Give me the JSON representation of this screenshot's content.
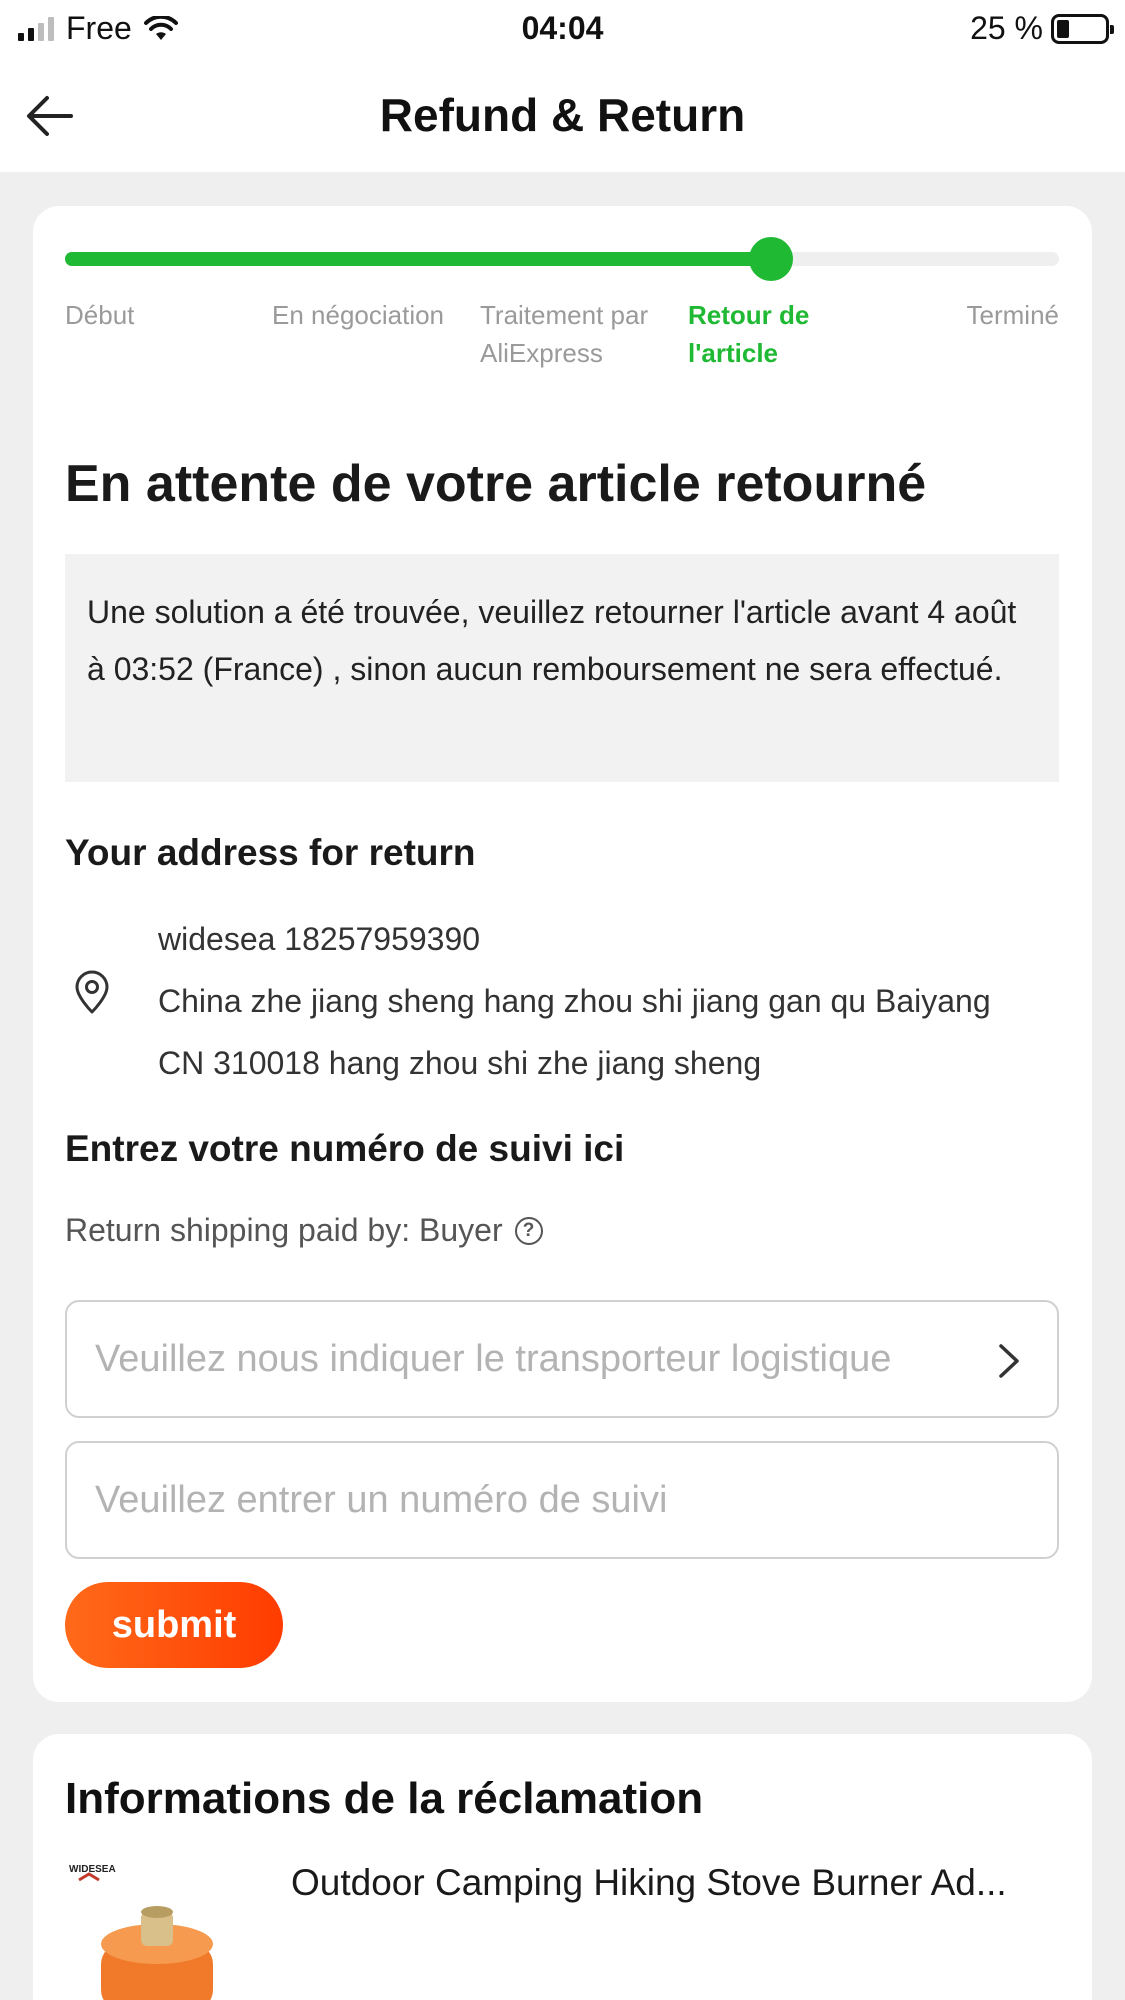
{
  "status_bar": {
    "carrier": "Free",
    "time": "04:04",
    "battery": "25 %"
  },
  "header": {
    "title": "Refund & Return"
  },
  "progress": {
    "completed_fraction": 0.71,
    "steps": [
      {
        "label": "Début",
        "active": false
      },
      {
        "label": "En négociation",
        "active": false
      },
      {
        "label": "Traitement par AliExpress",
        "active": false
      },
      {
        "label": "Retour de l'article",
        "active": true
      },
      {
        "label": "Terminé",
        "active": false
      }
    ]
  },
  "status": {
    "heading": "En attente de votre article retourné",
    "notice": "Une solution a été trouvée, veuillez retourner l'article avant 4 août à 03:52 (France) , sinon aucun remboursement ne sera effectué."
  },
  "address": {
    "title": "Your address for return",
    "name_phone": "widesea 18257959390",
    "line1": "China zhe jiang sheng hang zhou shi jiang gan qu Baiyang",
    "line2": "CN 310018 hang zhou shi zhe jiang sheng"
  },
  "tracking": {
    "title": "Entrez votre numéro de suivi ici",
    "shipping_paid": "Return shipping paid by: Buyer",
    "carrier_placeholder": "Veuillez nous indiquer le transporteur logistique",
    "tracking_placeholder": "Veuillez entrer un numéro de suivi",
    "submit_label": "submit"
  },
  "claim": {
    "title": "Informations de la réclamation",
    "brand_logo": "WIDESEA",
    "product_title": "Outdoor Camping Hiking Stove Burner Ad..."
  },
  "colors": {
    "accent_green": "#1fb934",
    "accent_orange": "#ff4f0f"
  }
}
